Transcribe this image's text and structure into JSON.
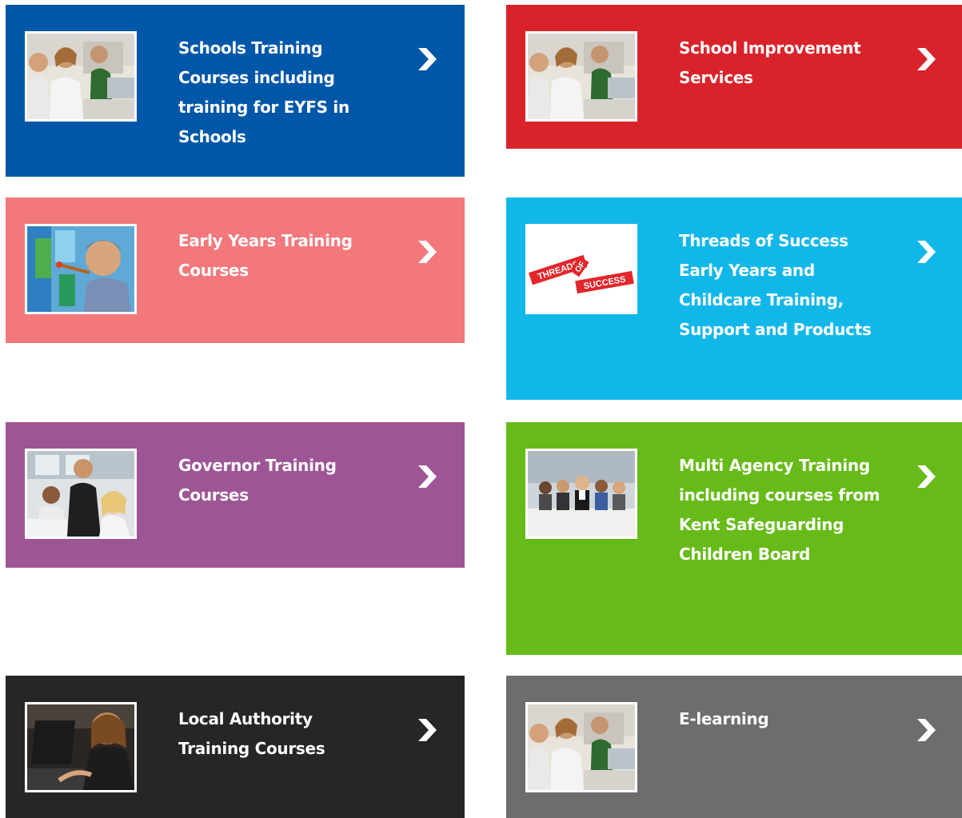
{
  "tiles": [
    {
      "id": "schools",
      "label": "Schools Training Courses including training for EYFS in Schools",
      "color": "#0057a8",
      "image": "classroom-students-photo"
    },
    {
      "id": "improve",
      "label": "School Improvement Services",
      "color": "#d9232b",
      "image": "classroom-students-photo"
    },
    {
      "id": "early",
      "label": "Early Years Training Courses",
      "color": "#f2787c",
      "image": "child-painting-photo"
    },
    {
      "id": "threads",
      "label": "Threads of Success Early Years and Childcare Training, Support and Products",
      "color": "#12b7ea",
      "image": "threads-of-success-logo",
      "logo_text": [
        "THREADS",
        "OF",
        "SUCCESS"
      ]
    },
    {
      "id": "governor",
      "label": "Governor Training Courses",
      "color": "#9e5595",
      "image": "governors-meeting-photo"
    },
    {
      "id": "multi",
      "label": "Multi Agency Training including courses from Kent Safeguarding Children Board",
      "color": "#66bb18",
      "image": "group-meeting-photo"
    },
    {
      "id": "local",
      "label": "Local Authority Training Courses",
      "color": "#262626",
      "image": "woman-laptop-photo"
    },
    {
      "id": "elearn",
      "label": "E-learning",
      "color": "#6d6d6d",
      "image": "classroom-students-photo"
    }
  ],
  "icons": {
    "arrow": "chevron-right-icon"
  }
}
